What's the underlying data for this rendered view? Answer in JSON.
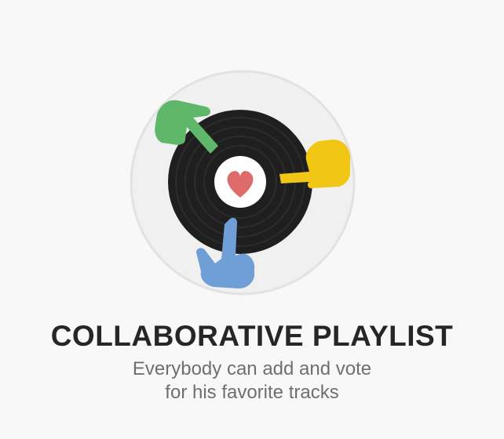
{
  "feature": {
    "icon": "collaborative-playlist-illustration",
    "title": "COLLABORATIVE PLAYLIST",
    "subtitle_lines": [
      "Everybody can add and vote",
      "for his favorite tracks"
    ]
  },
  "colors": {
    "background": "#f8f8f8",
    "badge_ring": "#e4e4e4",
    "badge_fill": "#f0f0f0",
    "record": "#1f1f1f",
    "label": "#ffffff",
    "heart": "#dd6b6b",
    "hand_green": "#5fb86a",
    "hand_yellow": "#f2c615",
    "hand_blue": "#6f9fd6",
    "title": "#262626",
    "subtitle": "#6f6f6f"
  }
}
